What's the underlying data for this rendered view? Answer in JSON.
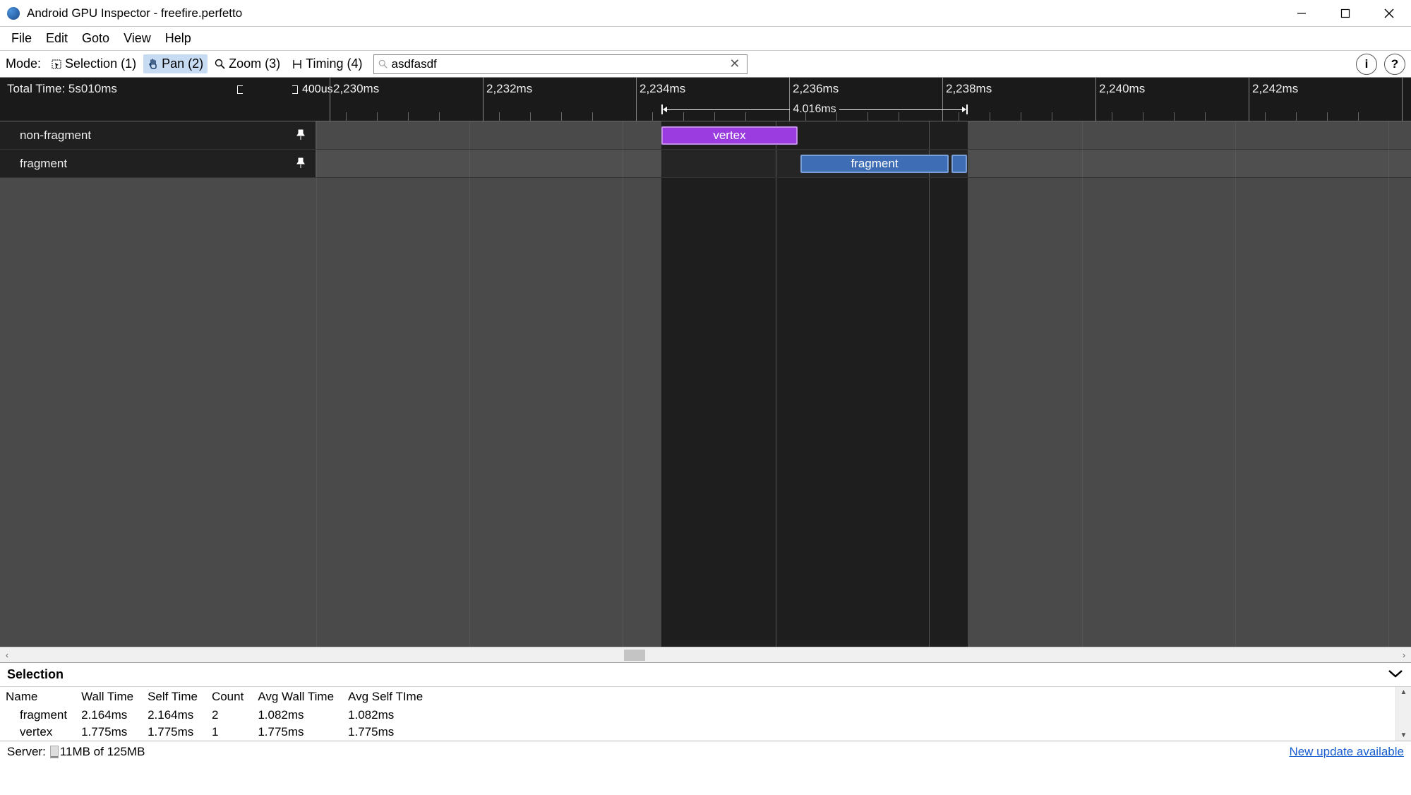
{
  "window": {
    "title": "Android GPU Inspector - freefire.perfetto"
  },
  "menu": {
    "items": [
      "File",
      "Edit",
      "Goto",
      "View",
      "Help"
    ]
  },
  "toolbar": {
    "mode_label": "Mode:",
    "modes": [
      {
        "label": "Selection (1)",
        "icon": "selection"
      },
      {
        "label": "Pan (2)",
        "icon": "pan",
        "active": true
      },
      {
        "label": "Zoom (3)",
        "icon": "zoom"
      },
      {
        "label": "Timing (4)",
        "icon": "timing"
      }
    ],
    "search_value": "asdfasdf"
  },
  "ruler": {
    "total_time": "Total Time: 5s010ms",
    "scale_label": "400us",
    "ticks": [
      "2,230ms",
      "2,232ms",
      "2,234ms",
      "2,236ms",
      "2,238ms",
      "2,240ms",
      "2,242ms"
    ],
    "range_label": "4.016ms"
  },
  "tracks": [
    {
      "name": "non-fragment",
      "slice": {
        "label": "vertex",
        "type": "vertex"
      }
    },
    {
      "name": "fragment",
      "slice": {
        "label": "fragment",
        "type": "fragment"
      }
    }
  ],
  "selection": {
    "title": "Selection",
    "columns": [
      "Name",
      "Wall Time",
      "Self Time",
      "Count",
      "Avg Wall Time",
      "Avg Self TIme"
    ],
    "rows": [
      {
        "name": "fragment",
        "wall": "2.164ms",
        "self": "2.164ms",
        "count": "2",
        "avg_wall": "1.082ms",
        "avg_self": "1.082ms"
      },
      {
        "name": "vertex",
        "wall": "1.775ms",
        "self": "1.775ms",
        "count": "1",
        "avg_wall": "1.775ms",
        "avg_self": "1.775ms"
      }
    ]
  },
  "statusbar": {
    "server_label": "Server:",
    "memory": "11MB of 125MB",
    "update_link": "New update available"
  }
}
